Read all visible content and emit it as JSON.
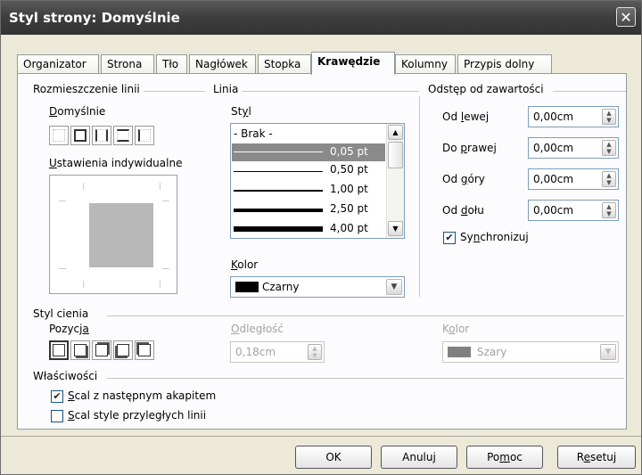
{
  "window": {
    "title": "Styl strony: Domyślnie",
    "close_glyph": "✕"
  },
  "tabs": [
    {
      "label": "Organizator"
    },
    {
      "label": "Strona"
    },
    {
      "label": "Tło"
    },
    {
      "label": "Nagłówek"
    },
    {
      "label": "Stopka"
    },
    {
      "label": "Krawędzie",
      "active": true
    },
    {
      "label": "Kolumny"
    },
    {
      "label": "Przypis dolny"
    }
  ],
  "line_arrangement": {
    "group_label": "Rozmieszczenie linii",
    "default_label_pre": "",
    "default_label_u": "D",
    "default_label_post": "omyślnie",
    "custom_label_pre": "",
    "custom_label_u": "U",
    "custom_label_post": "stawienia indywidualne"
  },
  "line": {
    "group_label": "Linia",
    "style_label_pre": "St",
    "style_label_u": "y",
    "style_label_post": "l",
    "styles": [
      {
        "label": "- Brak -"
      },
      {
        "label": "0,05 pt",
        "selected": true
      },
      {
        "label": "0,50 pt"
      },
      {
        "label": "1,00 pt"
      },
      {
        "label": "2,50 pt"
      },
      {
        "label": "4,00 pt"
      }
    ],
    "color_label_pre": "",
    "color_label_u": "K",
    "color_label_post": "olor",
    "color_value": "Czarny",
    "color_swatch": "#000000"
  },
  "spacing": {
    "group_label": "Odstęp od zawartości",
    "fields": [
      {
        "pre": "Od ",
        "u": "l",
        "post": "ewej",
        "value": "0,00cm"
      },
      {
        "pre": "Do ",
        "u": "p",
        "post": "rawej",
        "value": "0,00cm"
      },
      {
        "pre": "Od ",
        "u": "g",
        "post": "óry",
        "value": "0,00cm"
      },
      {
        "pre": "Od ",
        "u": "d",
        "post": "ołu",
        "value": "0,00cm"
      }
    ],
    "sync_pre": "Sy",
    "sync_u": "n",
    "sync_post": "chronizuj",
    "sync_checked": "✔"
  },
  "shadow": {
    "group_label": "Styl cienia",
    "position_pre": "Pozycj",
    "position_u": "a",
    "position_post": "",
    "distance_label_pre": "",
    "distance_label_u": "O",
    "distance_label_post": "dległość",
    "distance_value": "0,18cm",
    "color_label_pre": "K",
    "color_label_u": "o",
    "color_label_post": "lor",
    "color_value": "Szary",
    "color_swatch": "#808080"
  },
  "properties": {
    "group_label": "Właściwości",
    "merge_pre": "",
    "merge_u": "S",
    "merge_post": "cal z następnym akapitem",
    "merge_checked": "✔",
    "merge_adjacent_pre": "",
    "merge_adjacent_u": "S",
    "merge_adjacent_post": "cal style przyległych linii"
  },
  "buttons": {
    "ok": "OK",
    "cancel": "Anuluj",
    "help_pre": "Po",
    "help_u": "m",
    "help_post": "oc",
    "reset_pre": "R",
    "reset_u": "e",
    "reset_post": "setuj"
  }
}
